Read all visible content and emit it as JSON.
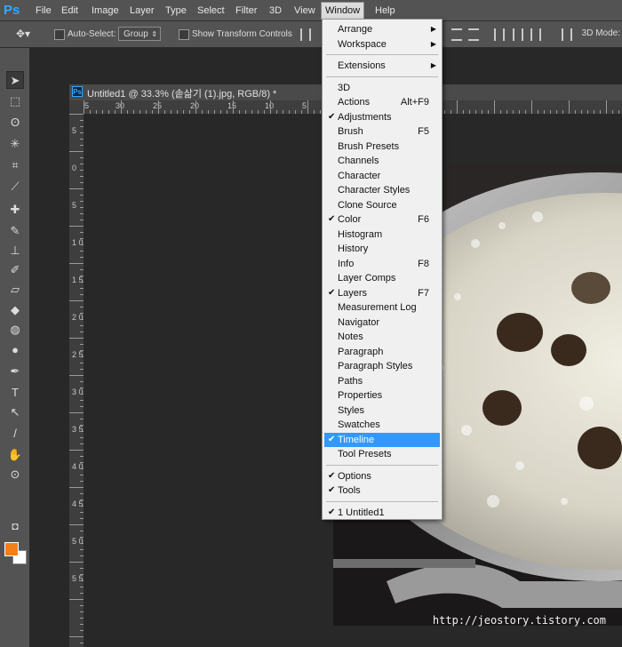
{
  "menubar": {
    "logo": "Ps",
    "items": [
      "File",
      "Edit",
      "Image",
      "Layer",
      "Type",
      "Select",
      "Filter",
      "3D",
      "View",
      "Window",
      "Help"
    ],
    "active_index": 9
  },
  "options": {
    "auto_select_label": "Auto-Select:",
    "group_value": "Group",
    "transform_label": "Show Transform Controls",
    "mode_3d_label": "3D Mode:"
  },
  "document": {
    "title": "Untitled1 @ 33.3% (솥삶기 (1).jpg, RGB/8) *",
    "badge": "Ps",
    "hruler_labels": [
      "5",
      "30",
      "25",
      "20",
      "15",
      "10",
      "5"
    ],
    "vruler_labels": [
      "5",
      "0",
      "5",
      "1 0",
      "1 5",
      "2 0",
      "2 5",
      "3 0",
      "3 5",
      "4 0",
      "4 5",
      "5 0",
      "5 5"
    ]
  },
  "window_menu": {
    "groups": [
      [
        {
          "label": "Arrange",
          "submenu": true
        },
        {
          "label": "Workspace",
          "submenu": true
        }
      ],
      [
        {
          "label": "Extensions",
          "submenu": true
        }
      ],
      [
        {
          "label": "3D"
        },
        {
          "label": "Actions",
          "shortcut": "Alt+F9"
        },
        {
          "label": "Adjustments",
          "checked": true
        },
        {
          "label": "Brush",
          "shortcut": "F5"
        },
        {
          "label": "Brush Presets"
        },
        {
          "label": "Channels"
        },
        {
          "label": "Character"
        },
        {
          "label": "Character Styles"
        },
        {
          "label": "Clone Source"
        },
        {
          "label": "Color",
          "shortcut": "F6",
          "checked": true
        },
        {
          "label": "Histogram"
        },
        {
          "label": "History"
        },
        {
          "label": "Info",
          "shortcut": "F8"
        },
        {
          "label": "Layer Comps"
        },
        {
          "label": "Layers",
          "shortcut": "F7",
          "checked": true
        },
        {
          "label": "Measurement Log"
        },
        {
          "label": "Navigator"
        },
        {
          "label": "Notes"
        },
        {
          "label": "Paragraph"
        },
        {
          "label": "Paragraph Styles"
        },
        {
          "label": "Paths"
        },
        {
          "label": "Properties"
        },
        {
          "label": "Styles"
        },
        {
          "label": "Swatches"
        },
        {
          "label": "Timeline",
          "checked": true,
          "highlighted": true
        },
        {
          "label": "Tool Presets"
        }
      ],
      [
        {
          "label": "Options",
          "checked": true
        },
        {
          "label": "Tools",
          "checked": true
        }
      ],
      [
        {
          "label": "1 Untitled1",
          "checked": true
        }
      ]
    ]
  },
  "watermark": "http://jeostory.tistory.com",
  "colors": {
    "foreground": "#f57f17",
    "background": "#ffffff",
    "highlight": "#3298fe"
  },
  "tools": [
    "move-tool-icon",
    "marquee-tool-icon",
    "lasso-tool-icon",
    "magic-wand-icon",
    "crop-tool-icon",
    "eyedropper-icon",
    "healing-brush-icon",
    "brush-tool-icon",
    "clone-stamp-icon",
    "history-brush-icon",
    "eraser-icon",
    "paint-bucket-icon",
    "blur-tool-icon",
    "dodge-tool-icon",
    "pen-tool-icon",
    "type-tool-icon",
    "path-selection-icon",
    "line-tool-icon",
    "hand-tool-icon",
    "zoom-tool-icon"
  ]
}
